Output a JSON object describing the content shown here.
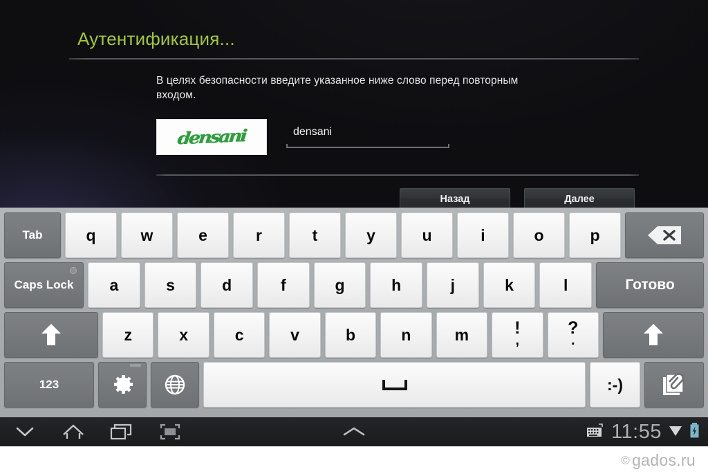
{
  "dialog": {
    "title": "Аутентификация...",
    "instruction": "В целях безопасности введите указанное ниже слово перед повторным входом.",
    "captcha": {
      "image_text": "densani",
      "image_color": "#2f9e3f",
      "image_background": "#fdfdfd"
    },
    "input": {
      "value": "densani",
      "placeholder": ""
    },
    "buttons": {
      "back": "Назад",
      "next": "Далее"
    },
    "title_color": "#a4c639"
  },
  "keyboard": {
    "row1": [
      {
        "label": "Tab",
        "name": "key-tab",
        "style": "dark",
        "width": "w-tab"
      },
      {
        "label": "q",
        "name": "key-q",
        "style": "light",
        "width": ""
      },
      {
        "label": "w",
        "name": "key-w",
        "style": "light",
        "width": ""
      },
      {
        "label": "e",
        "name": "key-e",
        "style": "light",
        "width": ""
      },
      {
        "label": "r",
        "name": "key-r",
        "style": "light",
        "width": ""
      },
      {
        "label": "t",
        "name": "key-t",
        "style": "light",
        "width": ""
      },
      {
        "label": "y",
        "name": "key-y",
        "style": "light",
        "width": ""
      },
      {
        "label": "u",
        "name": "key-u",
        "style": "light",
        "width": ""
      },
      {
        "label": "i",
        "name": "key-i",
        "style": "light",
        "width": ""
      },
      {
        "label": "o",
        "name": "key-o",
        "style": "light",
        "width": ""
      },
      {
        "label": "p",
        "name": "key-p",
        "style": "light",
        "width": ""
      },
      {
        "label": "",
        "name": "key-backspace",
        "style": "dark",
        "width": "w-bksp",
        "icon": "backspace-icon"
      }
    ],
    "row2": [
      {
        "label": "Caps Lock",
        "name": "key-caps-lock",
        "style": "dark",
        "width": "w-caps",
        "led": true
      },
      {
        "label": "a",
        "name": "key-a",
        "style": "light",
        "width": ""
      },
      {
        "label": "s",
        "name": "key-s",
        "style": "light",
        "width": ""
      },
      {
        "label": "d",
        "name": "key-d",
        "style": "light",
        "width": ""
      },
      {
        "label": "f",
        "name": "key-f",
        "style": "light",
        "width": ""
      },
      {
        "label": "g",
        "name": "key-g",
        "style": "light",
        "width": ""
      },
      {
        "label": "h",
        "name": "key-h",
        "style": "light",
        "width": ""
      },
      {
        "label": "j",
        "name": "key-j",
        "style": "light",
        "width": ""
      },
      {
        "label": "k",
        "name": "key-k",
        "style": "light",
        "width": ""
      },
      {
        "label": "l",
        "name": "key-l",
        "style": "light",
        "width": ""
      },
      {
        "label": "Готово",
        "name": "key-enter-done",
        "style": "dark",
        "width": "w-enter",
        "big": true
      }
    ],
    "row3": [
      {
        "label": "",
        "name": "key-shift-left",
        "style": "dark",
        "width": "w-shiftL",
        "icon": "shift-arrow-icon"
      },
      {
        "label": "z",
        "name": "key-z",
        "style": "light",
        "width": ""
      },
      {
        "label": "x",
        "name": "key-x",
        "style": "light",
        "width": ""
      },
      {
        "label": "c",
        "name": "key-c",
        "style": "light",
        "width": ""
      },
      {
        "label": "v",
        "name": "key-v",
        "style": "light",
        "width": ""
      },
      {
        "label": "b",
        "name": "key-b",
        "style": "light",
        "width": ""
      },
      {
        "label": "n",
        "name": "key-n",
        "style": "light",
        "width": ""
      },
      {
        "label": "m",
        "name": "key-m",
        "style": "light",
        "width": ""
      },
      {
        "label": "!",
        "sub": ",",
        "name": "key-exclam-comma",
        "style": "light",
        "width": ""
      },
      {
        "label": "?",
        "sub": ".",
        "name": "key-question-period",
        "style": "light",
        "width": ""
      },
      {
        "label": "",
        "name": "key-shift-right",
        "style": "dark",
        "width": "w-shiftR",
        "icon": "shift-arrow-icon"
      }
    ],
    "row4": [
      {
        "label": "123",
        "name": "key-numbers-123",
        "style": "dark",
        "width": "w-123"
      },
      {
        "label": "",
        "name": "key-settings",
        "style": "dark",
        "width": "w-sym",
        "icon": "gear-icon"
      },
      {
        "label": "",
        "name": "key-language",
        "style": "dark",
        "width": "w-sym",
        "icon": "globe-icon"
      },
      {
        "label": "",
        "name": "key-space",
        "style": "light",
        "width": "w-space",
        "icon": "space-icon"
      },
      {
        "label": ":-)",
        "name": "key-emoticon",
        "style": "light",
        "width": "w-emoji"
      },
      {
        "label": "",
        "name": "key-clipboard",
        "style": "dark",
        "width": "w-clip",
        "icon": "paperclip-icon"
      }
    ]
  },
  "system_bar": {
    "nav": [
      {
        "name": "nav-hide-keyboard-icon",
        "icon": "chevron-down-icon"
      },
      {
        "name": "nav-home-icon",
        "icon": "home-icon"
      },
      {
        "name": "nav-recents-icon",
        "icon": "recents-icon"
      },
      {
        "name": "nav-screenshot-icon",
        "icon": "screenshot-icon"
      }
    ],
    "center": {
      "name": "nav-expand-up-icon",
      "icon": "chevron-up-icon"
    },
    "clock": "11:55",
    "status_icons": [
      {
        "name": "keyboard-status-icon",
        "icon": "keyboard-icon"
      },
      {
        "name": "wifi-status-icon",
        "icon": "wifi-icon"
      },
      {
        "name": "battery-charging-icon",
        "icon": "battery-charging-icon"
      }
    ]
  },
  "watermark": {
    "copyright": "©",
    "text": "gados.ru"
  }
}
